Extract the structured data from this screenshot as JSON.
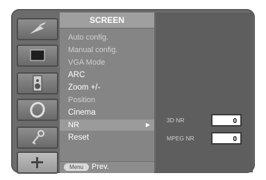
{
  "menu": {
    "title": "SCREEN",
    "items": [
      {
        "label": "Auto config."
      },
      {
        "label": "Manual config."
      },
      {
        "label": "VGA Mode"
      },
      {
        "label": "ARC"
      },
      {
        "label": "Zoom +/-"
      },
      {
        "label": "Position"
      },
      {
        "label": "Cinema"
      },
      {
        "label": "NR"
      },
      {
        "label": "Reset"
      }
    ],
    "selected_arrow": "▶"
  },
  "bottom": {
    "menu_button": "Menu",
    "prev_label": "Prev."
  },
  "submenu": {
    "rows": [
      {
        "label": "3D NR",
        "value": "0"
      },
      {
        "label": "MPEG NR",
        "value": "0"
      }
    ]
  },
  "icons": [
    "satellite-icon",
    "screen-icon",
    "speaker-icon",
    "clock-icon",
    "key-icon",
    "cross-icon"
  ]
}
